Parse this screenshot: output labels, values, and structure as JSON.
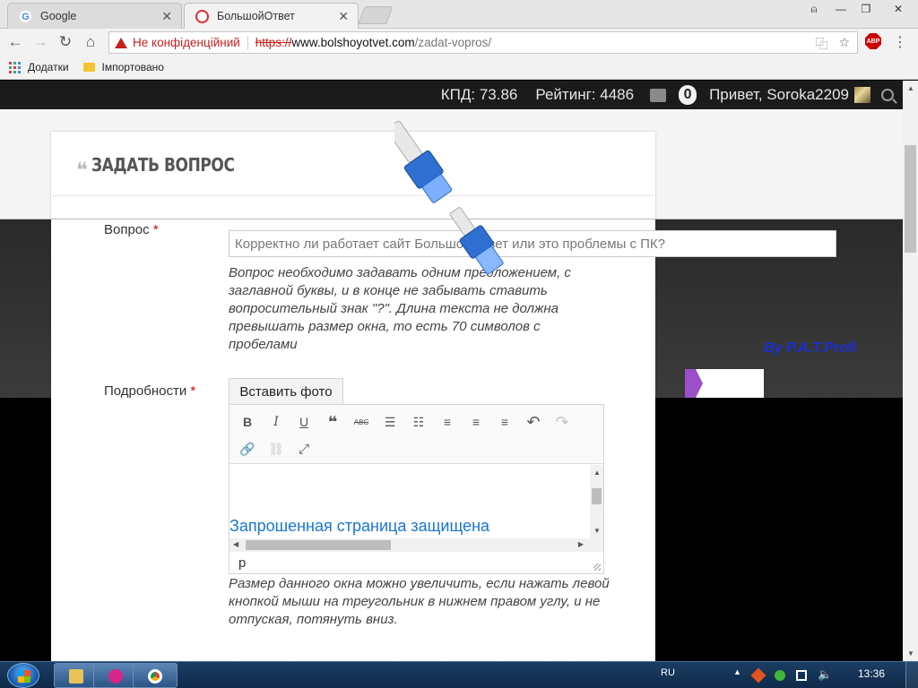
{
  "browser": {
    "tabs": [
      {
        "title": "Google",
        "favicon": "google-g-icon",
        "active": false
      },
      {
        "title": "БольшойОтвет",
        "favicon": "opera-o-icon",
        "active": true
      }
    ],
    "security_label": "Не конфіденційний",
    "url_scheme": "https://",
    "url_host": "www.bolshoyotvet.com",
    "url_path": "/zadat-vopros/",
    "bookmarks": [
      {
        "label": "Додатки",
        "icon": "apps-grid-icon"
      },
      {
        "label": "Імпортовано",
        "icon": "folder-icon"
      }
    ],
    "abp_label": "ABP"
  },
  "site_header": {
    "kpd": "КПД: 73.86",
    "rating": "Рейтинг: 4486",
    "notifications": "0",
    "greeting": "Привет, Soroka2209"
  },
  "page": {
    "title": "ЗАДАТЬ ВОПРОС",
    "question_label": "Вопрос",
    "required_mark": "*",
    "question_value": "Корректно ли работает сайт Большой ответ или это проблемы с ПК?",
    "question_hint": "Вопрос необходимо задавать одним предложением, с заглавной буквы, и в конце не забывать ставить вопросительный знак \"?\". Длина текста не должна превышать размер окна, то есть 70 символов с пробелами",
    "details_label": "Подробности",
    "insert_photo": "Вставить фото",
    "embedded_title": "Запрошенная страница защищена",
    "status_path": "p",
    "editor_hint": "Размер данного окна можно увеличить, если нажать левой кнопкой мыши на треугольник в нижнем правом углу, и не отпуская, потянуть вниз."
  },
  "overlay": {
    "credit_prefix": "By",
    "credit_name": "P.A.T.Profi"
  },
  "taskbar": {
    "language": "RU",
    "time": "13:36"
  },
  "colors": {
    "accent_link": "#1976d2",
    "required": "#dd0000",
    "topbar_bg": "#1b1b1b",
    "security_warning": "#c5221f"
  }
}
